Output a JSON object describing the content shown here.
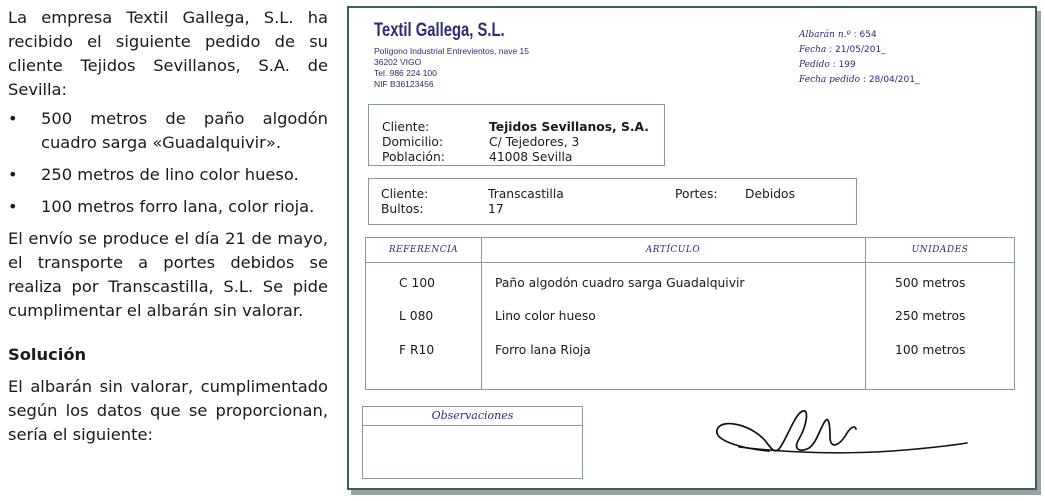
{
  "statement": {
    "intro": "La empresa Textil Gallega, S.L. ha recibido el siguiente pedido de su cliente Tejidos Sevillanos, S.A. de Sevilla:",
    "bullet_glyph": "•",
    "items": [
      "500 metros de paño algodón cuadro sarga «Guadalquivir».",
      "250 metros de lino color hueso.",
      "100 metros forro lana, color rioja."
    ],
    "body": "El envío se produce el día 21 de mayo, el transporte a portes debidos se realiza por Transcastilla, S.L. Se pide cumplimentar el albarán sin valorar.",
    "solution_heading": "Solución",
    "solution_text": "El albarán sin valorar, cumplimentado según los datos que se proporcionan, sería el siguiente:"
  },
  "delivery_note": {
    "company": {
      "name": "Textil Gallega, S.L.",
      "address": "Polígono Industrial Entrevientos, nave 15",
      "postal": "36202 VIGO",
      "phone": "Tel. 986 224 100",
      "nif": "NIF B36123456"
    },
    "meta": {
      "number_label": "Albarán n.º",
      "number": ": 654",
      "date_label": "Fecha",
      "date": ": 21/05/201_",
      "order_label": "Pedido",
      "order": ": 199",
      "order_date_label": "Fecha pedido",
      "order_date": ": 28/04/201_"
    },
    "client": {
      "client_label": "Cliente:",
      "client_value": "Tejidos Sevillanos, S.A.",
      "address_label": "Domicilio:",
      "address_value": "C/ Tejedores, 3",
      "city_label": "Población:",
      "city_value": "41008 Sevilla"
    },
    "shipping": {
      "carrier_label": "Cliente:",
      "carrier_value": "Transcastilla",
      "freight_label": "Portes:",
      "freight_value": "Debidos",
      "packages_label": "Bultos:",
      "packages_value": "17"
    },
    "table": {
      "headers": [
        "REFERENCIA",
        "ARTÍCULO",
        "UNIDADES"
      ],
      "rows": [
        [
          "C 100",
          "Paño algodón cuadro sarga Guadalquivir",
          "500 metros"
        ],
        [
          "L 080",
          "Lino color hueso",
          "250 metros"
        ],
        [
          "F R10",
          "Forro lana Rioja",
          "100 metros"
        ]
      ]
    },
    "observations_label": "Observaciones"
  },
  "colors": {
    "ink_blue": "#2c2c78",
    "border": "#3b5e5e",
    "rule": "#8a9898"
  }
}
